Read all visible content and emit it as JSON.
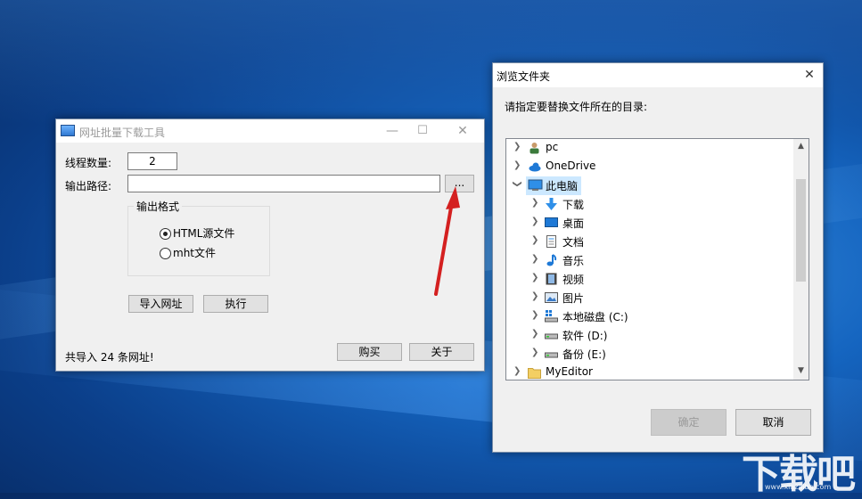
{
  "app_window": {
    "title": "网址批量下载工具",
    "controls": {
      "minimize": "—",
      "maximize": "☐",
      "close": "✕"
    },
    "thread_count_label": "线程数量:",
    "thread_count_value": "2",
    "output_path_label": "输出路径:",
    "output_path_value": "",
    "browse_button": "...",
    "format_group_title": "输出格式",
    "format_options": [
      {
        "label": "HTML源文件",
        "selected": true
      },
      {
        "label": "mht文件",
        "selected": false
      }
    ],
    "import_button": "导入网址",
    "run_button": "执行",
    "status_text": "共导入 24 条网址!",
    "buy_button": "购买",
    "about_button": "关于"
  },
  "folder_dialog": {
    "title": "浏览文件夹",
    "close": "✕",
    "instruction": "请指定要替换文件所在的目录:",
    "tree_items": [
      {
        "label": "pc",
        "icon": "user-icon",
        "expanded": false,
        "selected": false
      },
      {
        "label": "OneDrive",
        "icon": "cloud-icon",
        "expanded": false,
        "selected": false
      },
      {
        "label": "此电脑",
        "icon": "computer-icon",
        "expanded": true,
        "selected": true
      },
      {
        "label": "下载",
        "icon": "download-icon",
        "expanded": false,
        "selected": false
      },
      {
        "label": "桌面",
        "icon": "desktop-icon",
        "expanded": false,
        "selected": false
      },
      {
        "label": "文档",
        "icon": "document-icon",
        "expanded": false,
        "selected": false
      },
      {
        "label": "音乐",
        "icon": "music-icon",
        "expanded": false,
        "selected": false
      },
      {
        "label": "视频",
        "icon": "video-icon",
        "expanded": false,
        "selected": false
      },
      {
        "label": "图片",
        "icon": "picture-icon",
        "expanded": false,
        "selected": false
      },
      {
        "label": "本地磁盘 (C:)",
        "icon": "windows-drive-icon",
        "expanded": false,
        "selected": false
      },
      {
        "label": "软件 (D:)",
        "icon": "drive-icon",
        "expanded": false,
        "selected": false
      },
      {
        "label": "备份 (E:)",
        "icon": "drive-icon",
        "expanded": false,
        "selected": false
      },
      {
        "label": "MyEditor",
        "icon": "folder-icon",
        "expanded": false,
        "selected": false
      }
    ],
    "ok_button": "确定",
    "cancel_button": "取消"
  },
  "watermark": {
    "text": "下载吧",
    "url": "www.xiazaiba.com"
  },
  "colors": {
    "desktop": "#1565c0",
    "selection": "#cce8ff",
    "arrow": "#d42020"
  }
}
